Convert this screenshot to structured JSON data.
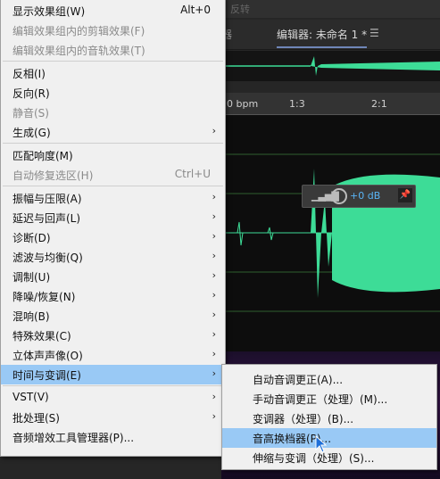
{
  "editor": {
    "top_partial_text": "反转",
    "tab_prev": "器",
    "tab_active": "编辑器: 未命名 1 *",
    "tab_menu_icon": "hamburger",
    "ruler": [
      "0 bpm",
      "1:3",
      "2:1"
    ],
    "hud": {
      "gain": "+0 dB"
    },
    "colors": {
      "waveform": "#3ddc97",
      "accent": "#59b4f5"
    }
  },
  "menu": {
    "items": [
      {
        "label": "显示效果组(W)",
        "shortcut": "Alt+0",
        "disabled": false,
        "submenu": false
      },
      {
        "label": "编辑效果组内的剪辑效果(F)",
        "shortcut": "",
        "disabled": true,
        "submenu": false
      },
      {
        "label": "编辑效果组内的音轨效果(T)",
        "shortcut": "",
        "disabled": true,
        "submenu": false
      },
      {
        "label": "反相(I)",
        "shortcut": "",
        "disabled": false,
        "submenu": false
      },
      {
        "label": "反向(R)",
        "shortcut": "",
        "disabled": false,
        "submenu": false
      },
      {
        "label": "静音(S)",
        "shortcut": "",
        "disabled": true,
        "submenu": false
      },
      {
        "label": "生成(G)",
        "shortcut": "",
        "disabled": false,
        "submenu": true
      },
      {
        "label": "匹配响度(M)",
        "shortcut": "",
        "disabled": false,
        "submenu": false
      },
      {
        "label": "自动修复选区(H)",
        "shortcut": "Ctrl+U",
        "disabled": true,
        "submenu": false
      },
      {
        "label": "振幅与压限(A)",
        "shortcut": "",
        "disabled": false,
        "submenu": true
      },
      {
        "label": "延迟与回声(L)",
        "shortcut": "",
        "disabled": false,
        "submenu": true
      },
      {
        "label": "诊断(D)",
        "shortcut": "",
        "disabled": false,
        "submenu": true
      },
      {
        "label": "滤波与均衡(Q)",
        "shortcut": "",
        "disabled": false,
        "submenu": true
      },
      {
        "label": "调制(U)",
        "shortcut": "",
        "disabled": false,
        "submenu": true
      },
      {
        "label": "降噪/恢复(N)",
        "shortcut": "",
        "disabled": false,
        "submenu": true
      },
      {
        "label": "混响(B)",
        "shortcut": "",
        "disabled": false,
        "submenu": true
      },
      {
        "label": "特殊效果(C)",
        "shortcut": "",
        "disabled": false,
        "submenu": true
      },
      {
        "label": "立体声声像(O)",
        "shortcut": "",
        "disabled": false,
        "submenu": true
      },
      {
        "label": "时间与变调(E)",
        "shortcut": "",
        "disabled": false,
        "submenu": true,
        "highlighted": true
      },
      {
        "label": "VST(V)",
        "shortcut": "",
        "disabled": false,
        "submenu": true
      },
      {
        "label": "批处理(S)",
        "shortcut": "",
        "disabled": false,
        "submenu": true
      },
      {
        "label": "音频增效工具管理器(P)...",
        "shortcut": "",
        "disabled": false,
        "submenu": false
      }
    ]
  },
  "submenu": {
    "items": [
      {
        "label": "自动音调更正(A)...",
        "highlighted": false
      },
      {
        "label": "手动音调更正（处理）(M)...",
        "highlighted": false
      },
      {
        "label": "变调器（处理）(B)...",
        "highlighted": false
      },
      {
        "label": "音高换档器(P)...",
        "highlighted": true
      },
      {
        "label": "伸缩与变调（处理）(S)...",
        "highlighted": false
      }
    ]
  }
}
